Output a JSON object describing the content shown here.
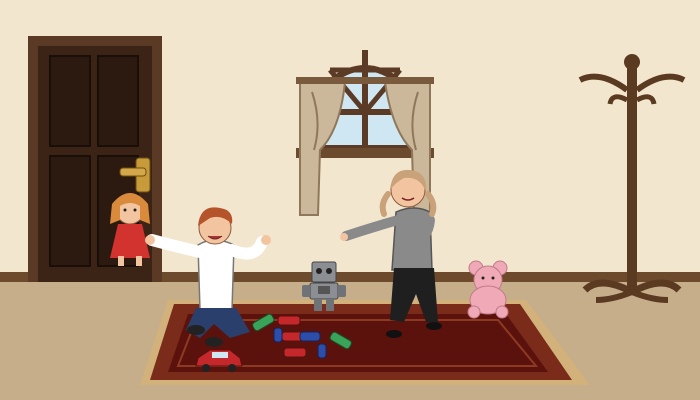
{
  "scene": {
    "kind": "illustrated-room",
    "objects": [
      "door",
      "doorknob",
      "arched-window",
      "curtains",
      "coat-rack",
      "rug",
      "rag-doll",
      "boy",
      "girl",
      "robot-toy",
      "teddy-bear",
      "toy-cars",
      "toy-car-red"
    ]
  },
  "palette": {
    "wall": "#f3e6cf",
    "baseboard": "#6e4a2c",
    "floor": "#c7ae8a",
    "door": "#3b2416",
    "door_frame": "#5a3a24",
    "window_frame": "#5b3a26",
    "sky": "#cfe7f3",
    "curtain": "#cbb79a",
    "rug_outer": "#7a2b1a",
    "rug_inner": "#5b120c",
    "rug_fringe": "#d2b27a",
    "coat_rack": "#5a3a20",
    "boy_shirt": "#ffffff",
    "boy_jeans": "#2a3f6b",
    "girl_top": "#8a8a8a",
    "girl_pants": "#1f1f1f",
    "doll_dress": "#d2332f",
    "teddy": "#f0a9b6",
    "robot": "#8b8f94"
  }
}
